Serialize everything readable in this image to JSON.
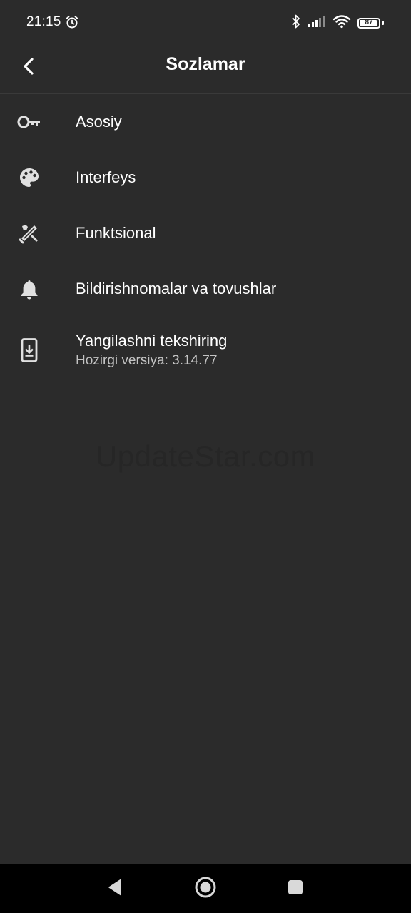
{
  "status_bar": {
    "time": "21:15",
    "battery_level": "87",
    "icons": [
      "alarm-icon",
      "bluetooth-icon",
      "signal-icon",
      "wifi-icon",
      "battery-icon"
    ]
  },
  "app_bar": {
    "title": "Sozlamar",
    "back_icon": "chevron-left-icon"
  },
  "settings": {
    "items": [
      {
        "icon": "key-icon",
        "title": "Asosiy"
      },
      {
        "icon": "palette-icon",
        "title": "Interfeys"
      },
      {
        "icon": "tools-icon",
        "title": "Funktsional"
      },
      {
        "icon": "bell-icon",
        "title": "Bildirishnomalar va tovushlar"
      },
      {
        "icon": "system-update-icon",
        "title": "Yangilashni tekshiring",
        "subtitle": "Hozirgi versiya: 3.14.77"
      }
    ]
  },
  "watermark": "UpdateStar.com",
  "nav_bar": {
    "icons": [
      "back-triangle-icon",
      "home-circle-icon",
      "recents-square-icon"
    ]
  },
  "colors": {
    "background": "#2b2b2b",
    "text_primary": "#ffffff",
    "text_secondary": "#c4c4c4",
    "icon": "#e0e0e0",
    "nav_background": "#000000"
  }
}
